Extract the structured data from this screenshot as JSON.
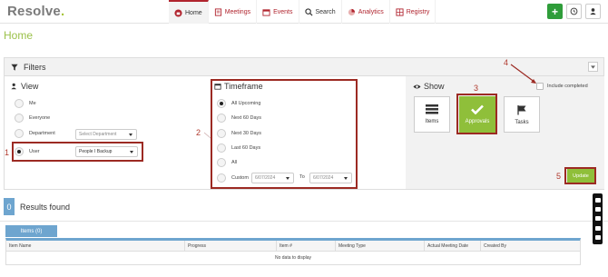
{
  "app": {
    "logo_text": "Resolve",
    "logo_dot": "."
  },
  "nav": [
    {
      "label": "Home",
      "icon": "home-icon"
    },
    {
      "label": "Meetings",
      "icon": "meetings-icon"
    },
    {
      "label": "Events",
      "icon": "calendar-icon"
    },
    {
      "label": "Search",
      "icon": "search-icon"
    },
    {
      "label": "Analytics",
      "icon": "analytics-icon"
    },
    {
      "label": "Registry",
      "icon": "registry-icon"
    }
  ],
  "toolbar": {
    "add_label": "+",
    "history_icon": "history-icon",
    "user_icon": "user-icon"
  },
  "page": {
    "title": "Home"
  },
  "filters": {
    "title": "Filters",
    "view": {
      "title": "View",
      "options": [
        {
          "label": "Me",
          "checked": false
        },
        {
          "label": "Everyone",
          "checked": false
        },
        {
          "label": "Department",
          "checked": false
        },
        {
          "label": "User",
          "checked": true
        }
      ],
      "department_placeholder": "Select Department",
      "user_value": "People I Backup"
    },
    "timeframe": {
      "title": "Timeframe",
      "options": [
        {
          "label": "All Upcoming",
          "checked": true
        },
        {
          "label": "Next 60 Days",
          "checked": false
        },
        {
          "label": "Next 30 Days",
          "checked": false
        },
        {
          "label": "Last 60 Days",
          "checked": false
        },
        {
          "label": "All",
          "checked": false
        },
        {
          "label": "Custom",
          "checked": false
        }
      ],
      "from_date": "6/07/2024",
      "to_label": "To",
      "to_date": "6/07/2024"
    },
    "show": {
      "title": "Show",
      "include_completed_label": "Include completed",
      "tiles": [
        {
          "label": "Items",
          "selected": false
        },
        {
          "label": "Approvals",
          "selected": true
        },
        {
          "label": "Tasks",
          "selected": false
        }
      ],
      "update_label": "Update"
    },
    "annotations": [
      "1",
      "2",
      "3",
      "4",
      "5"
    ]
  },
  "results": {
    "count": "0",
    "label": "Results found",
    "tab_label": "Items (0)",
    "columns": [
      "Item Name",
      "Progress",
      "Item #",
      "Meeting Type",
      "Actual Meeting Date",
      "Created By"
    ],
    "empty_text": "No data to display"
  },
  "colors": {
    "accent_red": "#b0242e",
    "accent_green": "#8fbf3a",
    "accent_blue": "#6ea5cf"
  }
}
